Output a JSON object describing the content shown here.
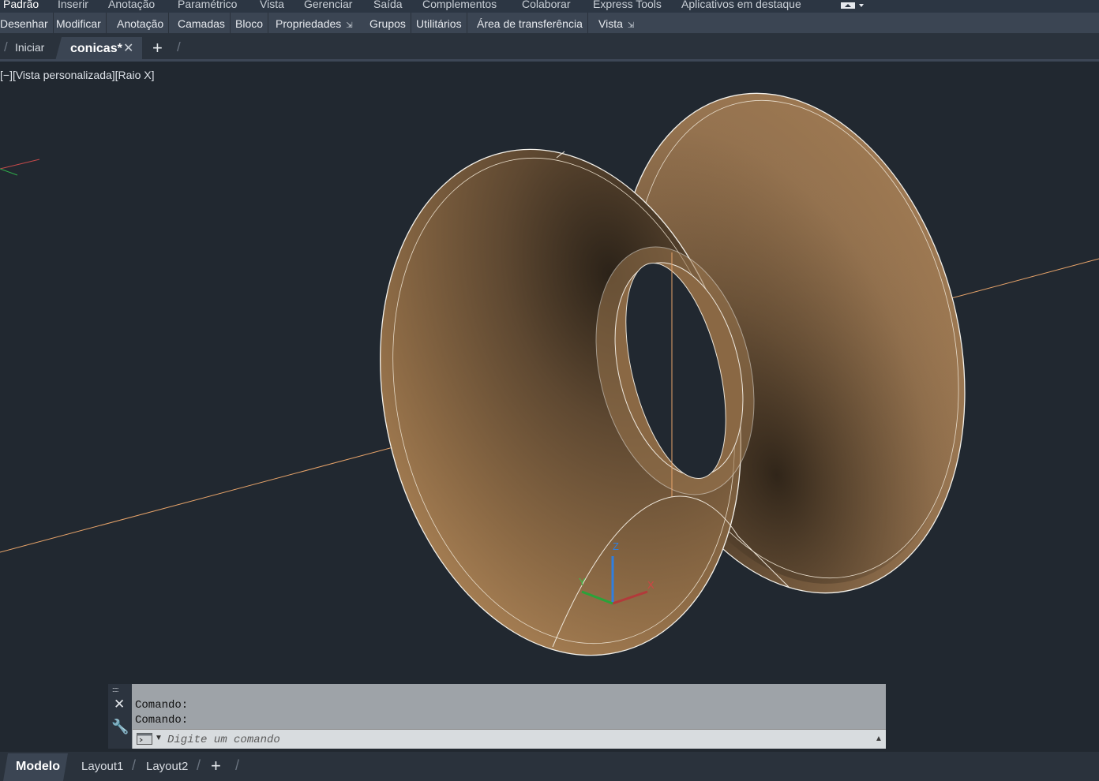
{
  "ribbon": {
    "tabs": [
      "Padrão",
      "Inserir",
      "Anotação",
      "Paramétrico",
      "Vista",
      "Gerenciar",
      "Saída",
      "Complementos",
      "Colaborar",
      "Express Tools",
      "Aplicativos em destaque"
    ],
    "active_tab": "Padrão",
    "panels": [
      "Desenhar",
      "Modificar",
      "Anotação",
      "Camadas",
      "Bloco",
      "Propriedades",
      "Grupos",
      "Utilitários",
      "Área de transferência",
      "Vista"
    ],
    "expander_icon": "expand-arrow-icon"
  },
  "document_tabs": {
    "tabs": [
      "Iniciar",
      "conicas*"
    ],
    "active": "conicas*",
    "close_icon": "close-icon",
    "add_icon": "plus-icon"
  },
  "viewport": {
    "label": "[−][Vista personalizada][Raio X]",
    "model_color": "#a57f52",
    "axis_line_color": "#f0a86a"
  },
  "command_line": {
    "history": [
      "Comando:",
      "Comando:"
    ],
    "placeholder": "Digite um comando",
    "close_icon": "close-icon",
    "customize_icon": "wrench-icon"
  },
  "layout_tabs": {
    "tabs": [
      "Modelo",
      "Layout1",
      "Layout2"
    ],
    "active": "Modelo",
    "add_icon": "plus-icon"
  }
}
